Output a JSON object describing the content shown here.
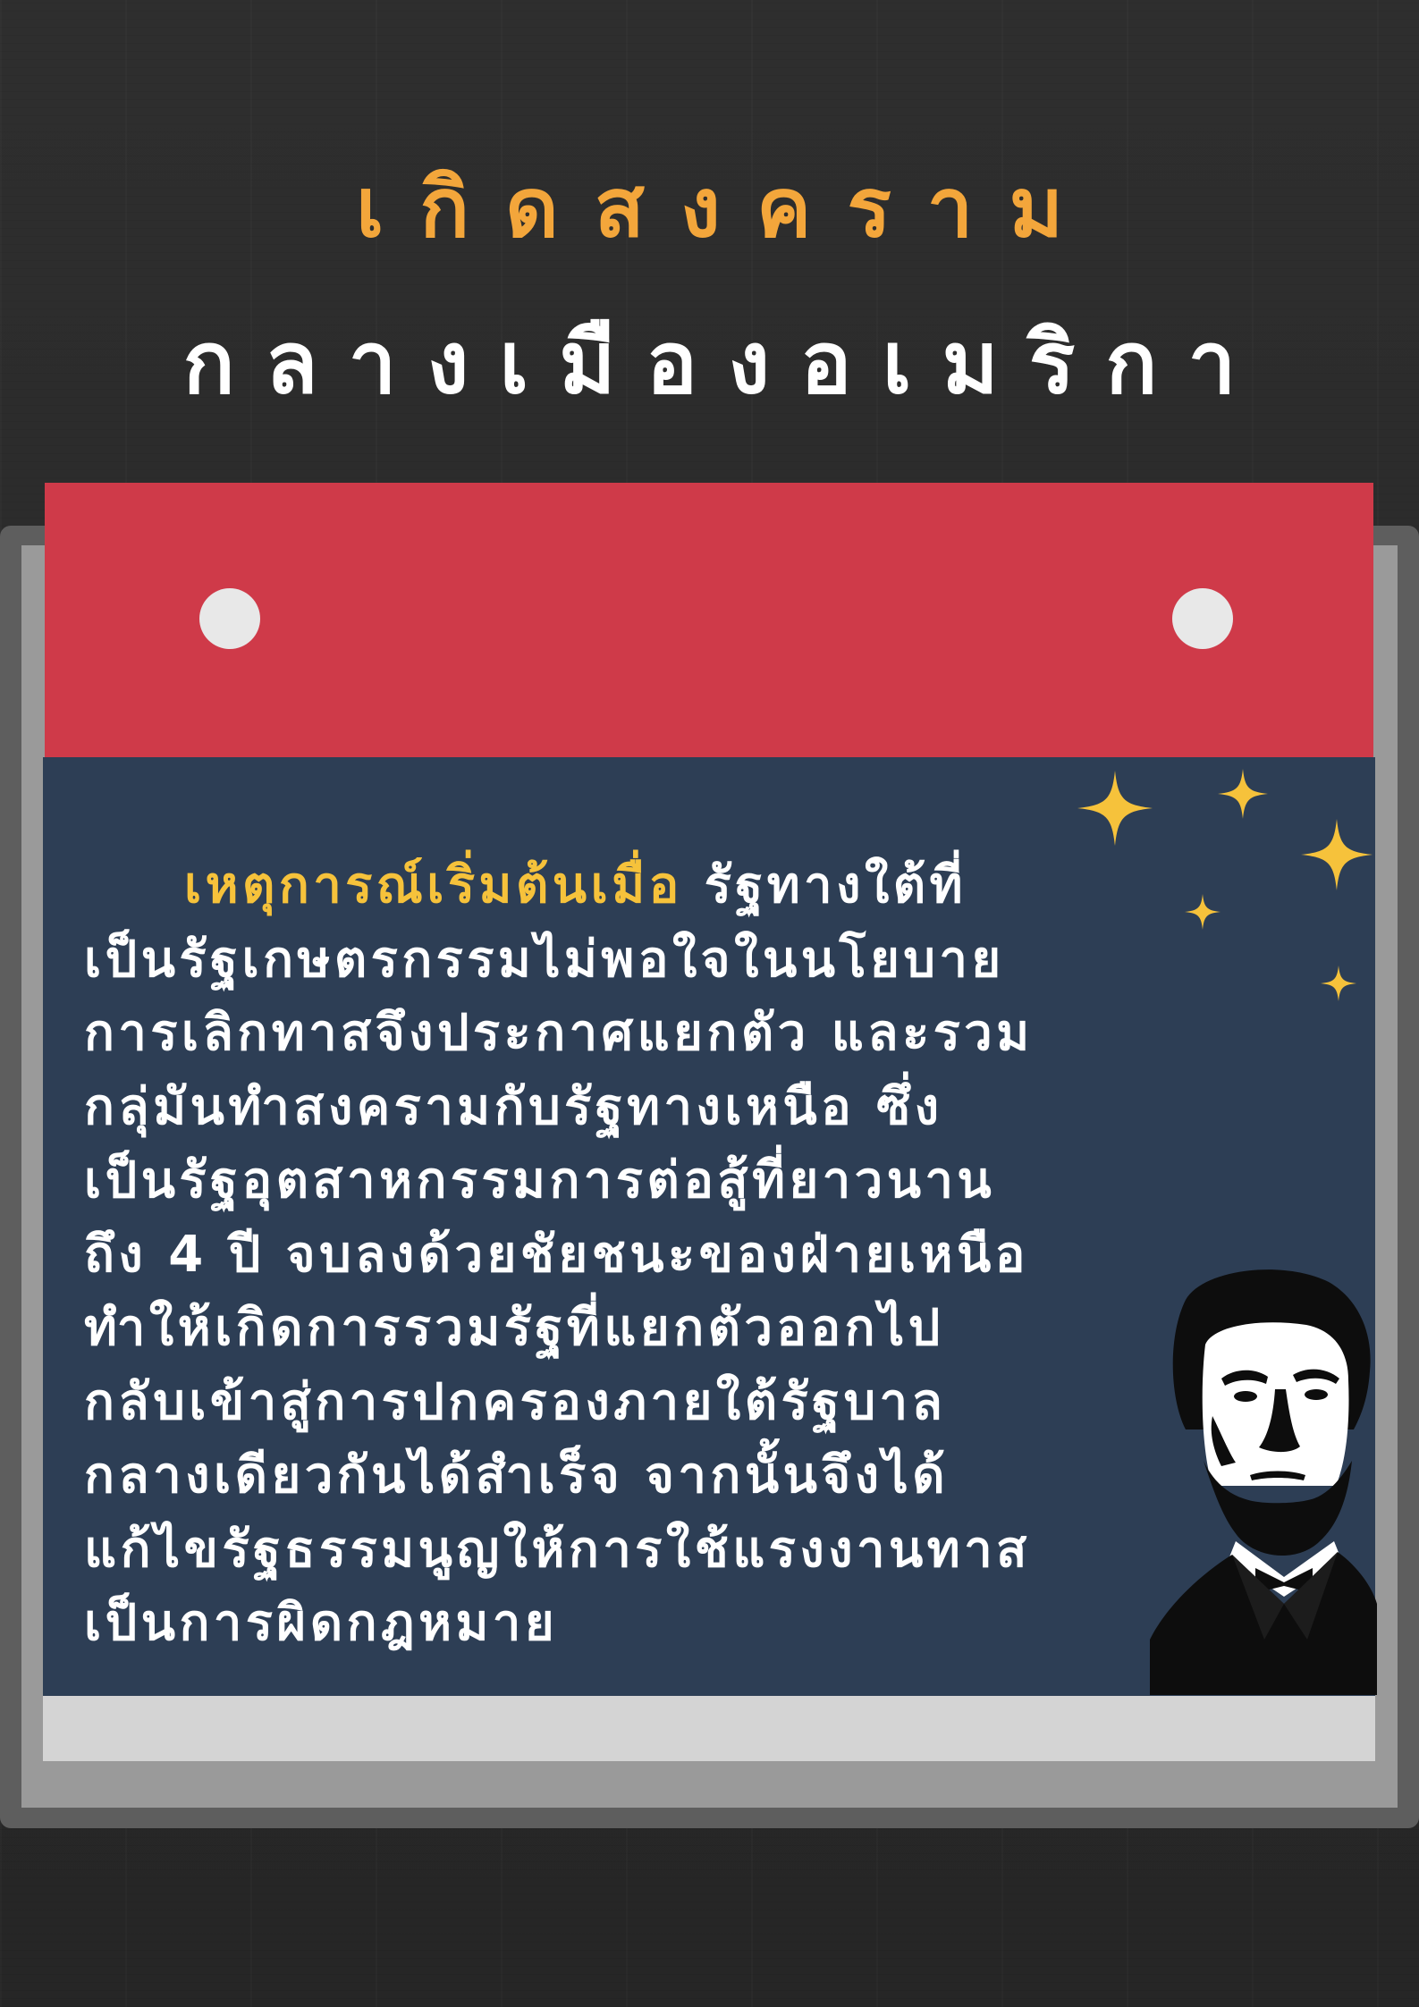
{
  "title": {
    "line1": "เกิดสงคราม",
    "line2": "กลางเมืองอเมริกา"
  },
  "body": {
    "lead": "เหตุการณ์เริ่มต้นเมื่อ",
    "lines": [
      " รัฐทางใต้ที่",
      "เป็นรัฐเกษตรกรรมไม่พอใจในนโยบาย",
      "การเลิกทาสจึงประกาศแยกตัว และรวม",
      "กลุ่มันทำสงครามกับรัฐทางเหนือ ซึ่ง",
      "เป็นรัฐอุตสาหกรรมการต่อสู้ที่ยาวนาน",
      "ถึง 4 ปี จบลงด้วยชัยชนะของฝ่ายเหนือ",
      "ทำให้เกิดการรวมรัฐที่แยกตัวออกไป",
      "กลับเข้าสู่การปกครองภายใต้รัฐบาล",
      "กลางเดียวกันได้สำเร็จ จากนั้นจึงได้",
      "แก้ไขรัฐธรรมนูญให้การใช้แรงงานทาส",
      "เป็นการผิดกฎหมาย"
    ]
  },
  "icons": {
    "stars": "sparkle-star-icon",
    "portrait": "lincoln-portrait-illustration"
  },
  "colors": {
    "background": "#2b2b2b",
    "title_accent": "#f3a63b",
    "title_main": "#ffffff",
    "calendar_header": "#cf3a49",
    "calendar_body": "#2d3e55",
    "lead_text": "#f6c23b",
    "star": "#f6c23b"
  }
}
